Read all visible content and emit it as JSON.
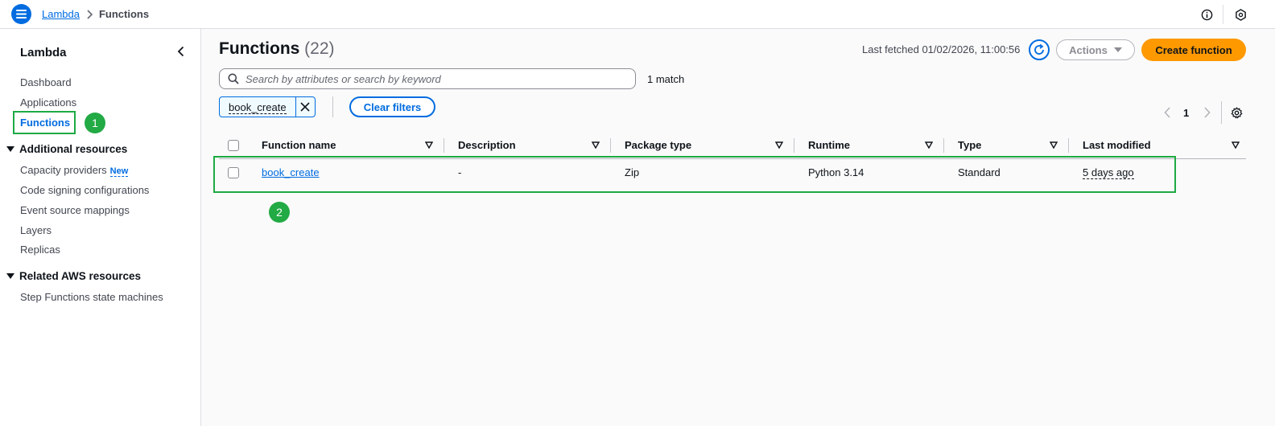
{
  "header": {
    "breadcrumbs": [
      "Lambda",
      "Functions"
    ]
  },
  "sidebar": {
    "title": "Lambda",
    "items": [
      {
        "label": "Dashboard"
      },
      {
        "label": "Applications"
      },
      {
        "label": "Functions",
        "active": true
      }
    ],
    "sections": [
      {
        "title": "Additional resources",
        "items": [
          {
            "label": "Capacity providers",
            "badge": "New"
          },
          {
            "label": "Code signing configurations"
          },
          {
            "label": "Event source mappings"
          },
          {
            "label": "Layers"
          },
          {
            "label": "Replicas"
          }
        ]
      },
      {
        "title": "Related AWS resources",
        "items": [
          {
            "label": "Step Functions state machines"
          }
        ]
      }
    ]
  },
  "main": {
    "title": "Functions",
    "count": "(22)",
    "last_fetched": "Last fetched 01/02/2026, 11:00:56",
    "actions_label": "Actions",
    "create_label": "Create function",
    "search_placeholder": "Search by attributes or search by keyword",
    "match_count": "1 match",
    "filter_token": "book_create",
    "clear_filters_label": "Clear filters",
    "page_number": "1"
  },
  "table": {
    "columns": [
      "Function name",
      "Description",
      "Package type",
      "Runtime",
      "Type",
      "Last modified"
    ],
    "rows": [
      {
        "function_name": "book_create",
        "description": "-",
        "package_type": "Zip",
        "runtime": "Python 3.14",
        "type": "Standard",
        "last_modified": "5 days ago"
      }
    ]
  },
  "annotations": [
    "1",
    "2"
  ],
  "colors": {
    "accent": "#006ce0",
    "primary_button": "#ff9900",
    "highlight": "#1eaa44"
  }
}
